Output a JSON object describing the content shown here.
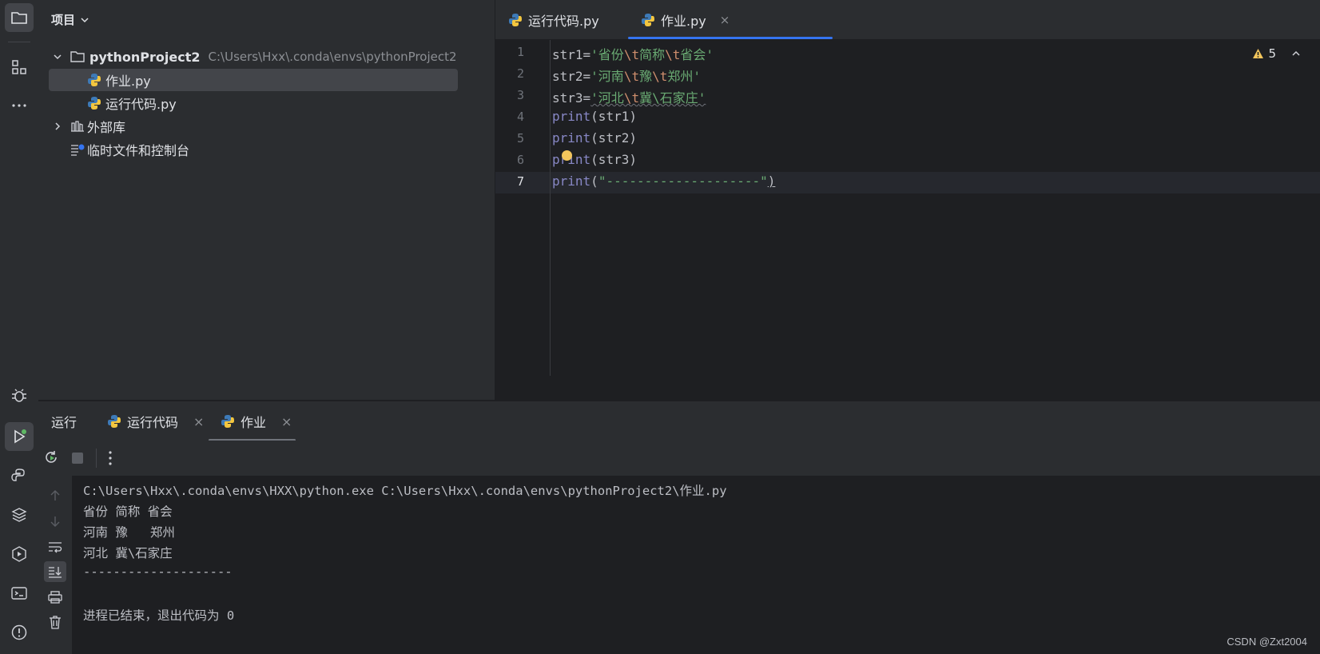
{
  "project_panel": {
    "title": "项目",
    "tree": [
      {
        "label": "pythonProject2",
        "path": "C:\\Users\\Hxx\\.conda\\envs\\pythonProject2"
      },
      {
        "label": "作业.py"
      },
      {
        "label": "运行代码.py"
      },
      {
        "label": "外部库"
      },
      {
        "label": "临时文件和控制台"
      }
    ]
  },
  "editor": {
    "tabs": [
      {
        "label": "运行代码.py"
      },
      {
        "label": "作业.py",
        "close": "×"
      }
    ],
    "warning_count": "5",
    "line_numbers": [
      "1",
      "2",
      "3",
      "4",
      "5",
      "6",
      "7"
    ],
    "lines": [
      {
        "var": "str1",
        "eq": "=",
        "parts": [
          "'省份",
          "\\t",
          "简称",
          "\\t",
          "省会'"
        ]
      },
      {
        "var": "str2",
        "eq": "=",
        "parts": [
          "'河南",
          "\\t",
          "豫",
          "\\t",
          "郑州'"
        ]
      },
      {
        "var": "str3",
        "eq": "=",
        "parts": [
          "'河北",
          "\\t",
          "冀\\石家庄'"
        ]
      },
      {
        "fn": "print",
        "arg": "(str1)"
      },
      {
        "fn": "print",
        "arg": "(str2)"
      },
      {
        "fn": "print",
        "arg": "(str3)"
      },
      {
        "fn": "print",
        "open": "(",
        "str": "\"--------------------\"",
        "close": ")"
      }
    ]
  },
  "run_window": {
    "title": "运行",
    "tabs": [
      {
        "label": "运行代码",
        "close": "×"
      },
      {
        "label": "作业",
        "close": "×"
      }
    ],
    "console_lines": [
      "C:\\Users\\Hxx\\.conda\\envs\\HXX\\python.exe C:\\Users\\Hxx\\.conda\\envs\\pythonProject2\\作业.py",
      "省份 简称 省会",
      "河南 豫   郑州",
      "河北 冀\\石家庄",
      "--------------------",
      "",
      "进程已结束，退出代码为 0"
    ]
  },
  "watermark": "CSDN @Zxt2004",
  "colors": {
    "background": "#1e1f22",
    "panel": "#2b2d30",
    "accent": "#3574f0",
    "keyword": "#8888c6",
    "string": "#6aab73",
    "escape": "#cf8e6d"
  }
}
